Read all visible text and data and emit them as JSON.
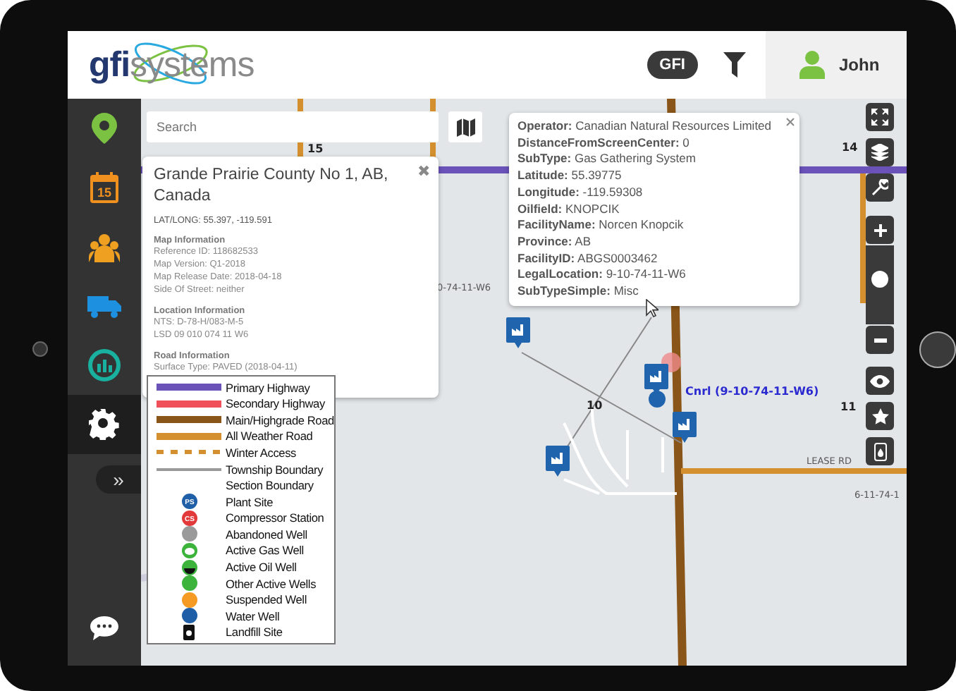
{
  "header": {
    "logo": {
      "bold": "gfi",
      "light": "systems"
    },
    "org_badge": "GFI",
    "user": "John"
  },
  "sidebar": {
    "items": [
      {
        "kind": "pin",
        "selected": false
      },
      {
        "kind": "calendar",
        "badge": "15",
        "selected": false
      },
      {
        "kind": "people",
        "selected": false
      },
      {
        "kind": "truck",
        "selected": false
      },
      {
        "kind": "chart",
        "selected": false
      },
      {
        "kind": "gear",
        "selected": true
      }
    ],
    "expand": "»"
  },
  "map": {
    "search": {
      "placeholder": "Search"
    },
    "labels": [
      {
        "text": "15",
        "kind": "section"
      },
      {
        "text": "14",
        "kind": "section"
      },
      {
        "text": "0-74-11-W6",
        "kind": "lsd"
      },
      {
        "text": "10",
        "kind": "section"
      },
      {
        "text": "11",
        "kind": "section"
      },
      {
        "text": "LEASE RD",
        "kind": "road"
      },
      {
        "text": "6-11-74-1",
        "kind": "lsd"
      },
      {
        "text": "Cnrl (9-10-74-11-W6)",
        "kind": "site"
      }
    ],
    "location_popup": {
      "title": "Grande Prairie County No 1, AB, Canada",
      "latlong": "LAT/LONG: 55.397, -119.591",
      "close": "✖",
      "sections": [
        {
          "heading": "Map Information",
          "lines": [
            "Reference ID: 118682533",
            "Map Version: Q1-2018",
            "Map Release Date: 2018-04-18",
            "Side Of Street: neither"
          ]
        },
        {
          "heading": "Location Information",
          "lines": [
            "NTS: D-78-H/083-M-5",
            "LSD 09 010 074 11 W6"
          ]
        },
        {
          "heading": "Road Information",
          "lines": [
            "Surface Type: PAVED (2018-04-11)"
          ]
        }
      ]
    },
    "facility_popup": {
      "fields": [
        {
          "label": "Operator:",
          "value": "Canadian Natural Resources Limited"
        },
        {
          "label": "DistanceFromScreenCenter:",
          "value": "0"
        },
        {
          "label": "SubType:",
          "value": "Gas Gathering System"
        },
        {
          "label": "Latitude:",
          "value": "55.39775"
        },
        {
          "label": "Longitude:",
          "value": "-119.59308"
        },
        {
          "label": "Oilfield:",
          "value": "KNOPCIK"
        },
        {
          "label": "FacilityName:",
          "value": "Norcen Knopcik"
        },
        {
          "label": "Province:",
          "value": "AB"
        },
        {
          "label": "FacilityID:",
          "value": "ABGS0003462"
        },
        {
          "label": "LegalLocation:",
          "value": "9-10-74-11-W6"
        },
        {
          "label": "SubTypeSimple:",
          "value": "Misc"
        }
      ]
    },
    "legend": [
      {
        "kind": "line",
        "label": "Primary Highway",
        "color": "#6a52b8"
      },
      {
        "kind": "line",
        "label": "Secondary Highway",
        "color": "#f0505a"
      },
      {
        "kind": "line",
        "label": "Main/Highgrade Road",
        "color": "#8a5518"
      },
      {
        "kind": "line",
        "label": "All Weather Road",
        "color": "#d4902e"
      },
      {
        "kind": "dashed",
        "label": "Winter Access",
        "color": "#d4902e"
      },
      {
        "kind": "thin",
        "label": "Township Boundary",
        "color": "#9a9a9a"
      },
      {
        "kind": "none",
        "label": "Section Boundary"
      },
      {
        "kind": "dot",
        "label": "Plant Site",
        "color": "#1f5fa8",
        "badge": "PS"
      },
      {
        "kind": "dot",
        "label": "Compressor Station",
        "color": "#e23a3a",
        "badge": "CS"
      },
      {
        "kind": "dot",
        "label": "Abandoned Well",
        "color": "#9a9a9a"
      },
      {
        "kind": "ring",
        "label": "Active Gas Well",
        "color": "#3cb43c"
      },
      {
        "kind": "half",
        "label": "Active Oil Well",
        "color": "#3cb43c"
      },
      {
        "kind": "dot",
        "label": "Other Active Wells",
        "color": "#3cb43c"
      },
      {
        "kind": "dot",
        "label": "Suspended Well",
        "color": "#f59a23"
      },
      {
        "kind": "dot",
        "label": "Water Well",
        "color": "#1f5fa8"
      },
      {
        "kind": "landfill",
        "label": "Landfill Site"
      }
    ],
    "zoom": {
      "level": 0.6
    }
  }
}
